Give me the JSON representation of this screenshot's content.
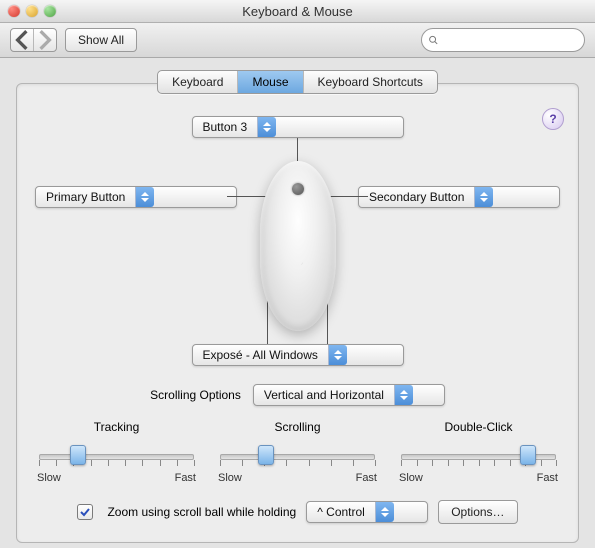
{
  "window": {
    "title": "Keyboard & Mouse"
  },
  "toolbar": {
    "show_all": "Show All",
    "search_placeholder": ""
  },
  "tabs": {
    "keyboard": "Keyboard",
    "mouse": "Mouse",
    "shortcuts": "Keyboard Shortcuts",
    "active": "mouse"
  },
  "help_label": "?",
  "mouse_buttons": {
    "scroll_ball": "Button 3",
    "left": "Primary Button",
    "right": "Secondary Button",
    "squeeze": "Exposé - All Windows"
  },
  "scrolling_options": {
    "label": "Scrolling Options",
    "value": "Vertical and Horizontal"
  },
  "sliders": {
    "tracking": {
      "label": "Tracking",
      "low": "Slow",
      "high": "Fast",
      "value_pct": 26,
      "ticks": 10
    },
    "scrolling": {
      "label": "Scrolling",
      "low": "Slow",
      "high": "Fast",
      "value_pct": 30,
      "ticks": 8
    },
    "double_click": {
      "label": "Double-Click",
      "low": "Slow",
      "high": "Fast",
      "value_pct": 80,
      "ticks": 11
    }
  },
  "zoom": {
    "checked": true,
    "label": "Zoom using scroll ball while holding",
    "modifier": "^ Control",
    "options_button": "Options…"
  }
}
